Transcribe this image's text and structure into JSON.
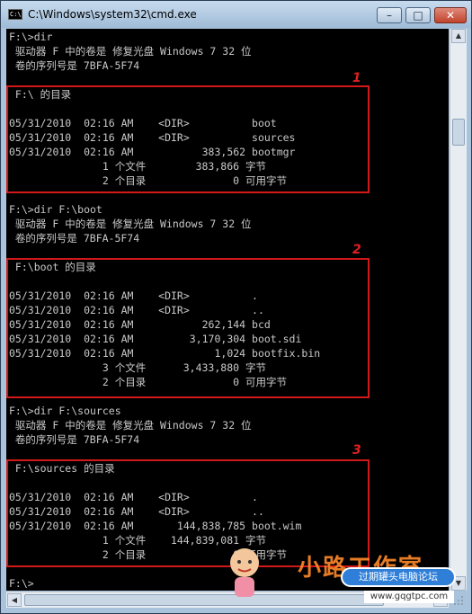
{
  "window": {
    "title": "C:\\Windows\\system32\\cmd.exe",
    "icon_label": "C:\\",
    "controls": {
      "minimize": "–",
      "maximize": "□",
      "close": "✕"
    }
  },
  "console": {
    "lines": [
      "F:\\>dir",
      " 驱动器 F 中的卷是 修复光盘 Windows 7 32 位",
      " 卷的序列号是 7BFA-5F74",
      "",
      " F:\\ 的目录",
      "",
      "05/31/2010  02:16 AM    <DIR>          boot",
      "05/31/2010  02:16 AM    <DIR>          sources",
      "05/31/2010  02:16 AM           383,562 bootmgr",
      "               1 个文件        383,866 字节",
      "               2 个目录              0 可用字节",
      "",
      "F:\\>dir F:\\boot",
      " 驱动器 F 中的卷是 修复光盘 Windows 7 32 位",
      " 卷的序列号是 7BFA-5F74",
      "",
      " F:\\boot 的目录",
      "",
      "05/31/2010  02:16 AM    <DIR>          .",
      "05/31/2010  02:16 AM    <DIR>          ..",
      "05/31/2010  02:16 AM           262,144 bcd",
      "05/31/2010  02:16 AM         3,170,304 boot.sdi",
      "05/31/2010  02:16 AM             1,024 bootfix.bin",
      "               3 个文件      3,433,880 字节",
      "               2 个目录              0 可用字节",
      "",
      "F:\\>dir F:\\sources",
      " 驱动器 F 中的卷是 修复光盘 Windows 7 32 位",
      " 卷的序列号是 7BFA-5F74",
      "",
      " F:\\sources 的目录",
      "",
      "05/31/2010  02:16 AM    <DIR>          .",
      "05/31/2010  02:16 AM    <DIR>          ..",
      "05/31/2010  02:16 AM       144,838,785 boot.wim",
      "               1 个文件    144,839,081 字节",
      "               2 个目录              0 可用字节",
      "",
      "F:\\>"
    ]
  },
  "annotations": [
    "1",
    "2",
    "3"
  ],
  "watermark": {
    "logo": "小路工作室",
    "badge": "过期罐头电脑论坛",
    "url": "www.gqgtpc.com"
  },
  "colors": {
    "annotation_red": "#d11919",
    "console_bg": "#000000",
    "console_fg": "#c8c8c8"
  }
}
